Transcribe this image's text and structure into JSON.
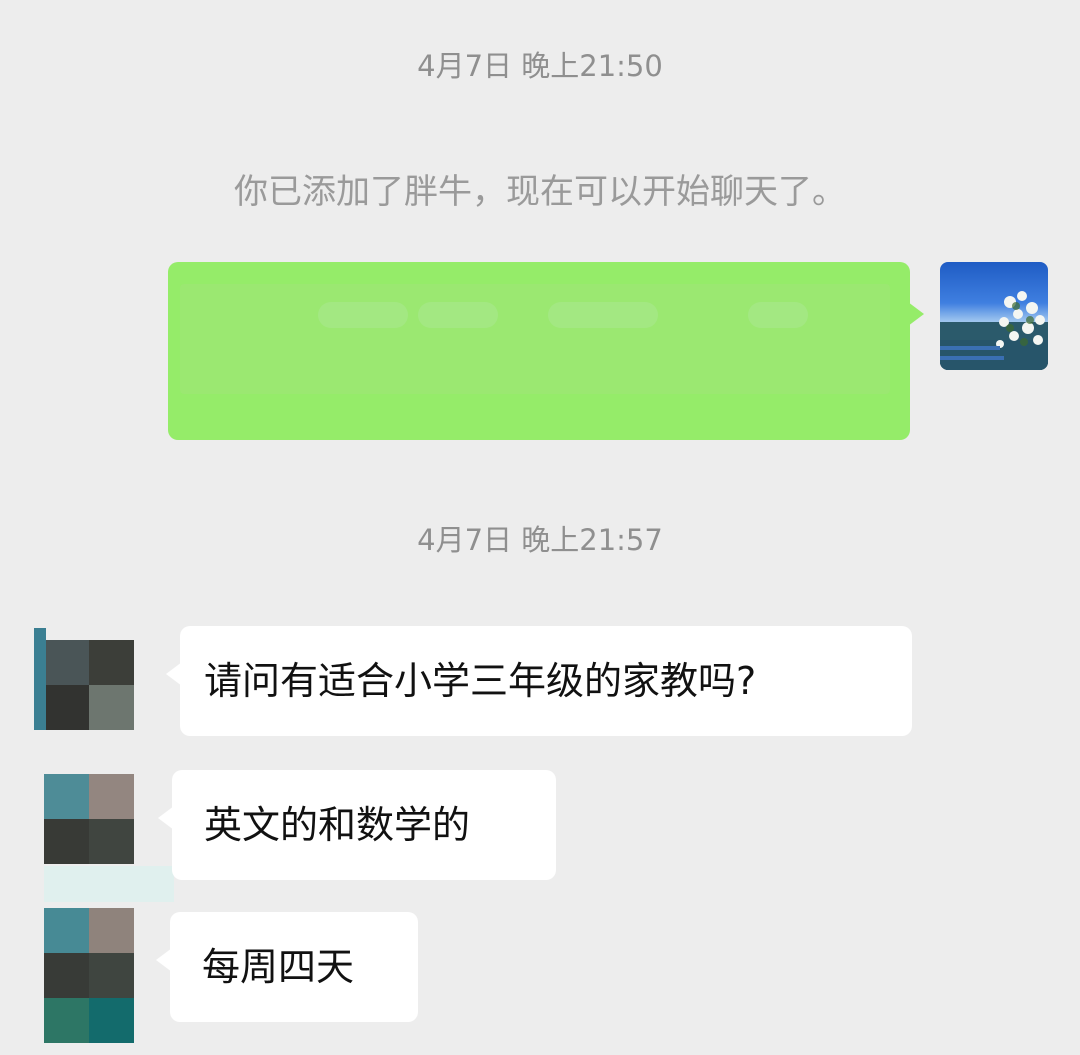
{
  "chat": {
    "timestamp_1": "4月7日 晚上21:50",
    "system_note": "你已添加了胖牛，现在可以开始聊天了。",
    "timestamp_2": "4月7日 晚上21:57",
    "messages": [
      {
        "text": "请问有适合小学三年级的家教吗?"
      },
      {
        "text": "英文的和数学的"
      },
      {
        "text": "每周四天"
      }
    ]
  },
  "colors": {
    "background": "#ededed",
    "outgoing_bubble": "#95ec69",
    "incoming_bubble": "#ffffff",
    "timestamp_text": "#8f8f8f"
  },
  "icons": {
    "self_avatar": "scenic-photo-avatar",
    "contact_avatar": "pixelated-avatar"
  }
}
